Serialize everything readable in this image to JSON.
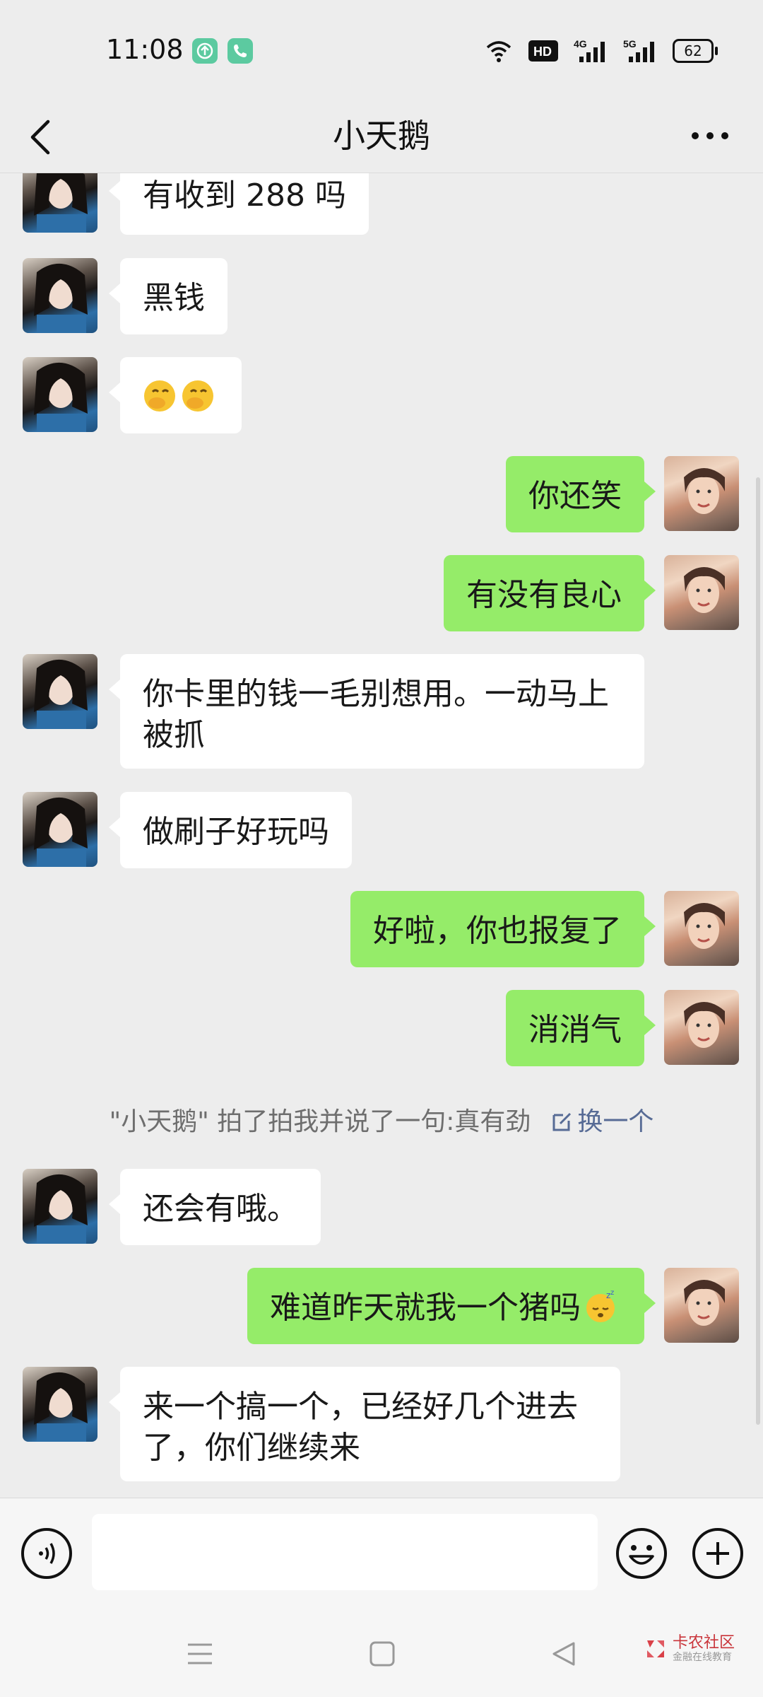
{
  "status_bar": {
    "time": "11:08",
    "network_4g": "4G",
    "network_5g": "5G",
    "hd_label": "HD",
    "battery": "62",
    "icons": [
      "upload-app-icon",
      "phone-app-icon",
      "wifi-icon",
      "hd-icon",
      "signal-4g-icon",
      "signal-5g-icon",
      "battery-icon"
    ]
  },
  "header": {
    "title": "小天鹅",
    "back_icon": "chevron-left-icon",
    "more_icon": "more-dots-icon"
  },
  "messages": [
    {
      "sender": "other",
      "text": "有收到 288 吗"
    },
    {
      "sender": "other",
      "text": "黑钱"
    },
    {
      "sender": "other",
      "text": "",
      "emojis": [
        "hand-over-mouth-emoji",
        "hand-over-mouth-emoji"
      ]
    },
    {
      "sender": "me",
      "text": "你还笑"
    },
    {
      "sender": "me",
      "text": "有没有良心"
    },
    {
      "sender": "other",
      "text_line1": "你卡里的钱一毛别想用。一动马上",
      "text_line2": "被抓"
    },
    {
      "sender": "other",
      "text": "做刷子好玩吗"
    },
    {
      "sender": "me",
      "text": "好啦，你也报复了"
    },
    {
      "sender": "me",
      "text": "消消气"
    },
    {
      "sender": "other",
      "text": "还会有哦。"
    },
    {
      "sender": "me",
      "text": "难道昨天就我一个猪吗",
      "emoji": "sleeping-face-emoji"
    },
    {
      "sender": "other",
      "text_line1": "来一个搞一个，已经好几个进去",
      "text_line2": "了，你们继续来"
    }
  ],
  "system_notice": {
    "text": "\"小天鹅\" 拍了拍我并说了一句:真有劲",
    "link": "换一个"
  },
  "input_bar": {
    "voice_icon": "voice-icon",
    "emoji_icon": "emoji-icon",
    "plus_icon": "plus-icon",
    "value": ""
  },
  "nav_bar": {
    "icons": [
      "menu-icon",
      "home-icon",
      "back-icon"
    ],
    "watermark_main": "卡农社区",
    "watermark_sub": "金融在线教育"
  },
  "colors": {
    "background": "#ededed",
    "my_bubble": "#95ec69",
    "other_bubble": "#ffffff",
    "link": "#576b95"
  }
}
